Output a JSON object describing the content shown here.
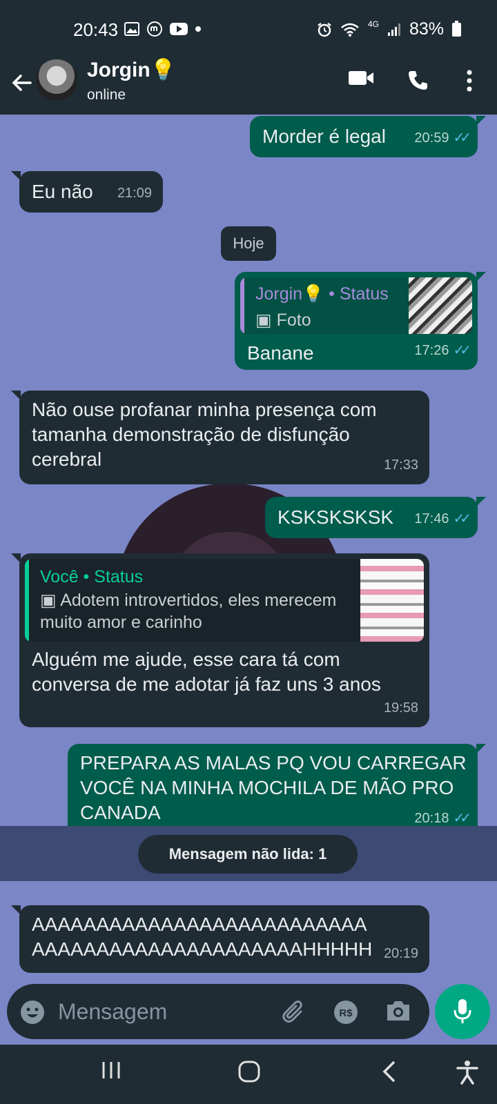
{
  "status_bar": {
    "time": "20:43",
    "network": "4G",
    "battery": "83%"
  },
  "header": {
    "contact_name": "Jorgin💡",
    "contact_status": "online"
  },
  "date_separator": "Hoje",
  "messages": [
    {
      "direction": "out",
      "text": "Morder é legal",
      "time": "20:59"
    },
    {
      "direction": "in",
      "text": "Eu não",
      "time": "21:09"
    },
    {
      "direction": "out",
      "quote_title": "Jorgin💡",
      "quote_tag": "Status",
      "quote_sub": "Foto",
      "text": "Banane",
      "time": "17:26"
    },
    {
      "direction": "in",
      "text": "Não ouse profanar minha presença com tamanha demonstração de disfunção cerebral",
      "time": "17:33"
    },
    {
      "direction": "out",
      "text": "KSKSKSKSK",
      "time": "17:46"
    },
    {
      "direction": "in",
      "quote_title": "Você",
      "quote_tag": "Status",
      "quote_sub": "Adotem introvertidos, eles merecem muito amor e carinho",
      "text": "Alguém me ajude, esse cara tá com conversa de me adotar já faz uns 3 anos",
      "time": "19:58"
    },
    {
      "direction": "out",
      "text": "PREPARA AS MALAS PQ VOU CARREGAR VOCÊ NA MINHA MOCHILA DE MÃO PRO CANADA",
      "time": "20:18"
    },
    {
      "direction": "in",
      "text": "AAAAAAAAAAAAAAAAAAAAAAAAAAAAAAAAAAAAAAAAAAAAAAAHHHHH",
      "time": "20:19"
    }
  ],
  "unread_banner": "Mensagem não lida: 1",
  "composer": {
    "placeholder": "Mensagem"
  },
  "colors": {
    "wallpaper": "#7b86c7",
    "incoming": "#202c33",
    "outgoing": "#005c4b",
    "accent": "#00a884",
    "read_ticks": "#53bdeb"
  }
}
